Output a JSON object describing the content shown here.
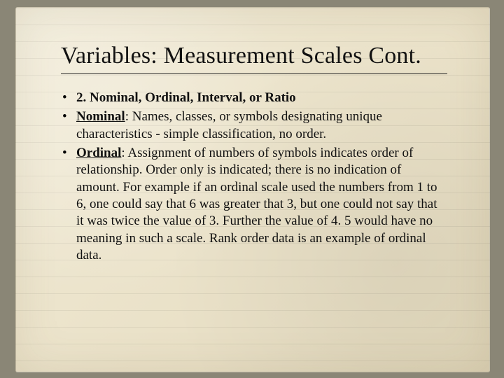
{
  "title": "Variables: Measurement Scales Cont.",
  "bullets": {
    "item1_bold": "2. Nominal, Ordinal, Interval, or Ratio",
    "item2_label": "Nominal",
    "item2_rest": ": Names, classes, or symbols designating unique characteristics - simple classification, no order.",
    "item3_label": "Ordinal",
    "item3_rest": ": Assignment of numbers of symbols indicates order of relationship. Order only is indicated; there is no indication of amount. For example if an ordinal scale used the numbers from 1 to 6, one could say that 6 was greater that 3, but one could not say that it was twice the value of 3. Further the value of 4. 5 would have no meaning in such a scale. Rank order data is an example of ordinal data."
  }
}
